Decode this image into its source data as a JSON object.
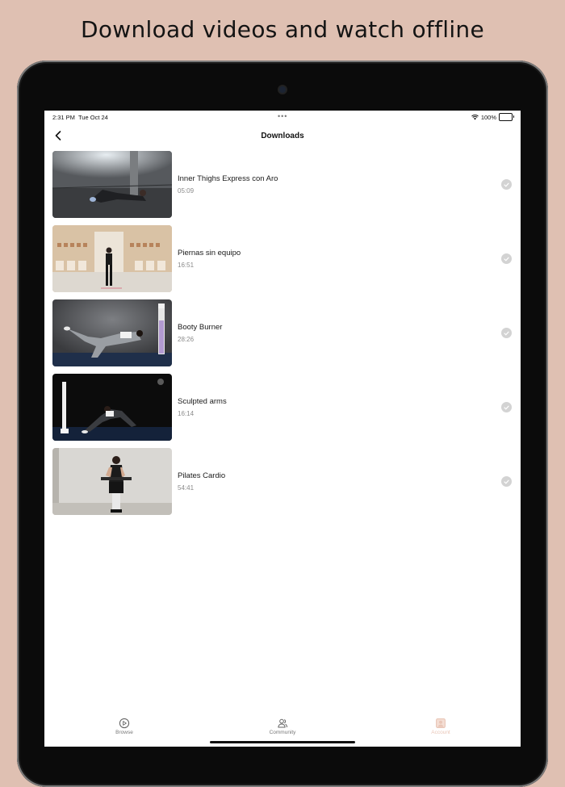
{
  "headline": "Download videos and watch offline",
  "status_bar": {
    "time": "2:31 PM",
    "date": "Tue Oct 24",
    "battery": "100%"
  },
  "nav": {
    "title": "Downloads"
  },
  "downloads": [
    {
      "title": "Inner Thighs Express con Aro",
      "duration": "05:09"
    },
    {
      "title": "Piernas sin equipo",
      "duration": "16:51"
    },
    {
      "title": "Booty Burner",
      "duration": "28:26"
    },
    {
      "title": "Sculpted arms",
      "duration": "16:14"
    },
    {
      "title": "Pilates Cardio",
      "duration": "54:41"
    }
  ],
  "tabs": [
    {
      "label": "Browse",
      "icon": "play-circle-icon"
    },
    {
      "label": "Community",
      "icon": "people-icon"
    },
    {
      "label": "Account",
      "icon": "account-icon",
      "active": true
    }
  ],
  "colors": {
    "background": "#dfc0b2",
    "active_tab": "#e9c6b7",
    "check": "#d3d3d3"
  }
}
